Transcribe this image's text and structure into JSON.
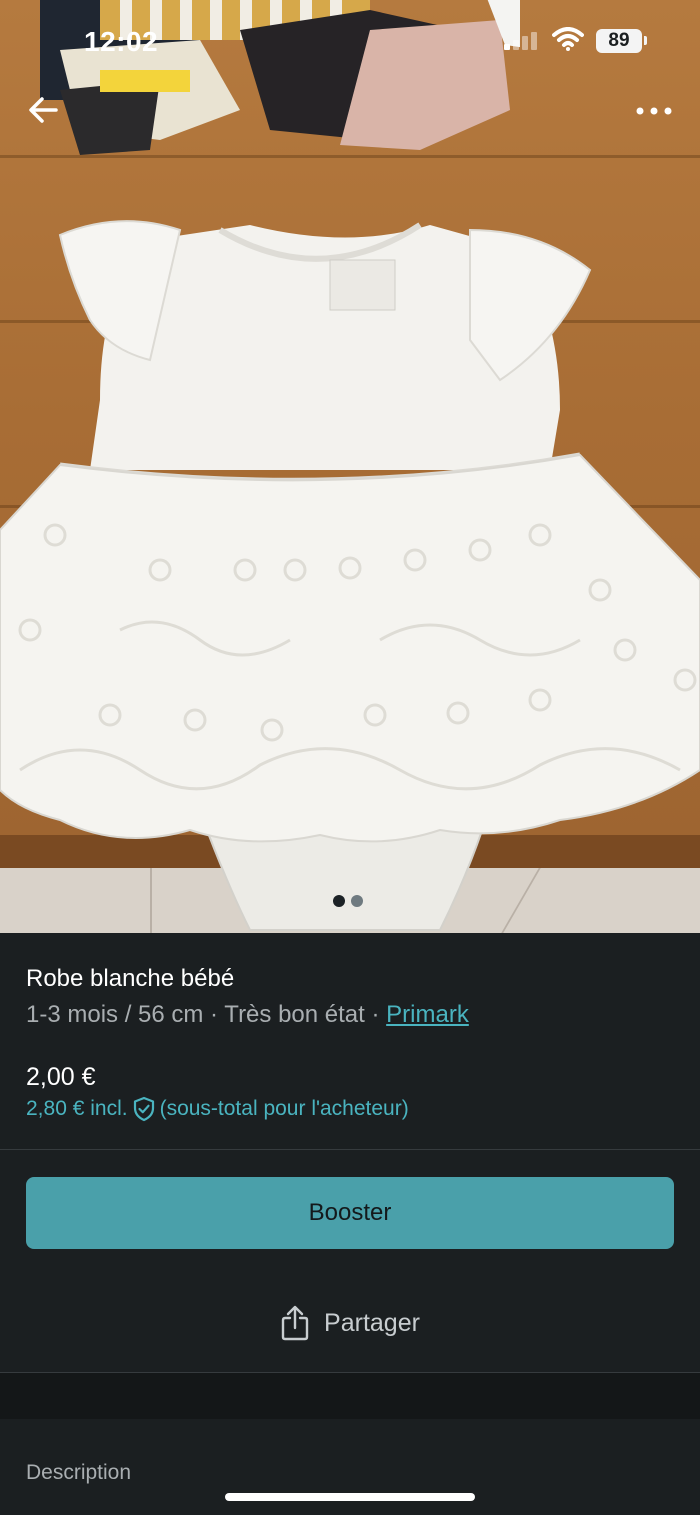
{
  "status_bar": {
    "time": "12:02",
    "battery": "89"
  },
  "photo": {
    "image_count": 2,
    "active_index": 0
  },
  "item": {
    "title": "Robe blanche bébé",
    "size": "1-3 mois / 56 cm",
    "condition": "Très bon état",
    "separator": " · ",
    "brand": "Primark",
    "price": "2,00 €",
    "price_incl": "2,80 € incl.",
    "price_note": "(sous-total pour l'acheteur)"
  },
  "actions": {
    "booster_label": "Booster",
    "share_label": "Partager"
  },
  "sections": {
    "description_label": "Description"
  },
  "colors": {
    "accent": "#4aa0aa",
    "link": "#4ab4c0",
    "background": "#1b1f21"
  }
}
